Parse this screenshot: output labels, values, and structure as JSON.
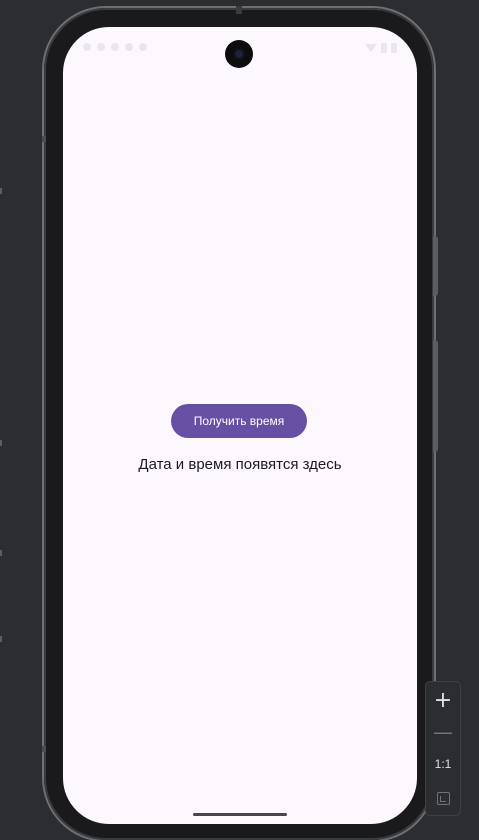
{
  "app": {
    "action_button_label": "Получить время",
    "result_text": "Дата и время появятся здесь"
  },
  "zoom_controls": {
    "zoom_in_glyph": "+",
    "zoom_out_glyph": "—",
    "reset_label": "1:1",
    "fit_icon": "fit-screen-icon"
  },
  "colors": {
    "ide_background": "#2b2d30",
    "screen_background": "#fdf7fe",
    "button_background": "#6750a4",
    "button_text": "#ffffff",
    "result_text": "#1d1b20"
  }
}
